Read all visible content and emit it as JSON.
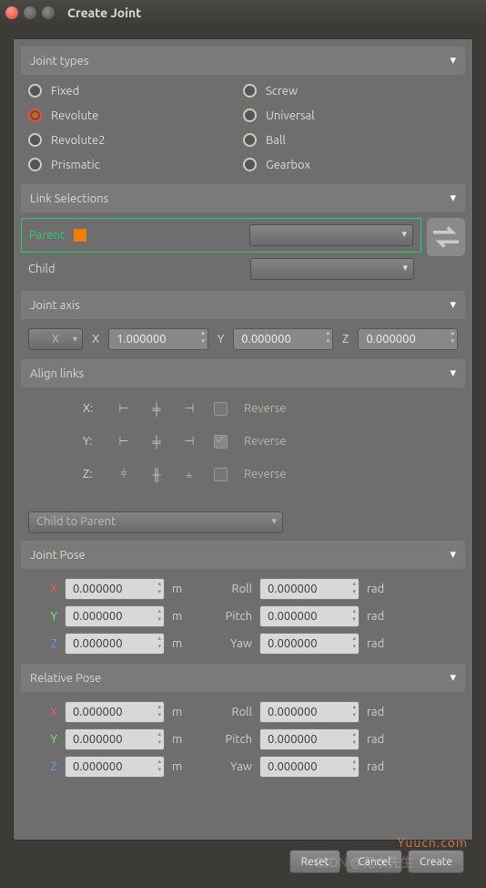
{
  "window": {
    "title": "Create Joint"
  },
  "sections": {
    "types": "Joint types",
    "links": "Link Selections",
    "axis": "Joint axis",
    "align": "Align links",
    "pose": "Joint Pose",
    "relpose": "Relative Pose"
  },
  "joint_types": {
    "options": [
      "Fixed",
      "Revolute",
      "Revolute2",
      "Prismatic",
      "Screw",
      "Universal",
      "Ball",
      "Gearbox"
    ],
    "selected": "Revolute"
  },
  "links": {
    "parent_label": "Parent",
    "child_label": "Child",
    "parent_value": "",
    "child_value": ""
  },
  "axis": {
    "selector": "X",
    "x_label": "X",
    "x_value": "1.000000",
    "y_label": "Y",
    "y_value": "0.000000",
    "z_label": "Z",
    "z_value": "0.000000"
  },
  "align": {
    "rows": [
      {
        "label": "X:",
        "reverse_label": "Reverse",
        "reverse": false
      },
      {
        "label": "Y:",
        "reverse_label": "Reverse",
        "reverse": true
      },
      {
        "label": "Z:",
        "reverse_label": "Reverse",
        "reverse": false
      }
    ],
    "mode": "Child to Parent"
  },
  "pose": {
    "x": "0.000000",
    "y": "0.000000",
    "z": "0.000000",
    "roll": "0.000000",
    "pitch": "0.000000",
    "yaw": "0.000000",
    "x_label": "X",
    "y_label": "Y",
    "z_label": "Z",
    "roll_label": "Roll",
    "pitch_label": "Pitch",
    "yaw_label": "Yaw",
    "m": "m",
    "rad": "rad"
  },
  "relpose": {
    "x": "0.000000",
    "y": "0.000000",
    "z": "0.000000",
    "roll": "0.000000",
    "pitch": "0.000000",
    "yaw": "0.000000"
  },
  "buttons": {
    "reset": "Reset",
    "cancel": "Cancel",
    "create": "Create"
  },
  "watermarks": {
    "site": "Yuucn.com",
    "csdn": "CSDN @无水先生"
  }
}
